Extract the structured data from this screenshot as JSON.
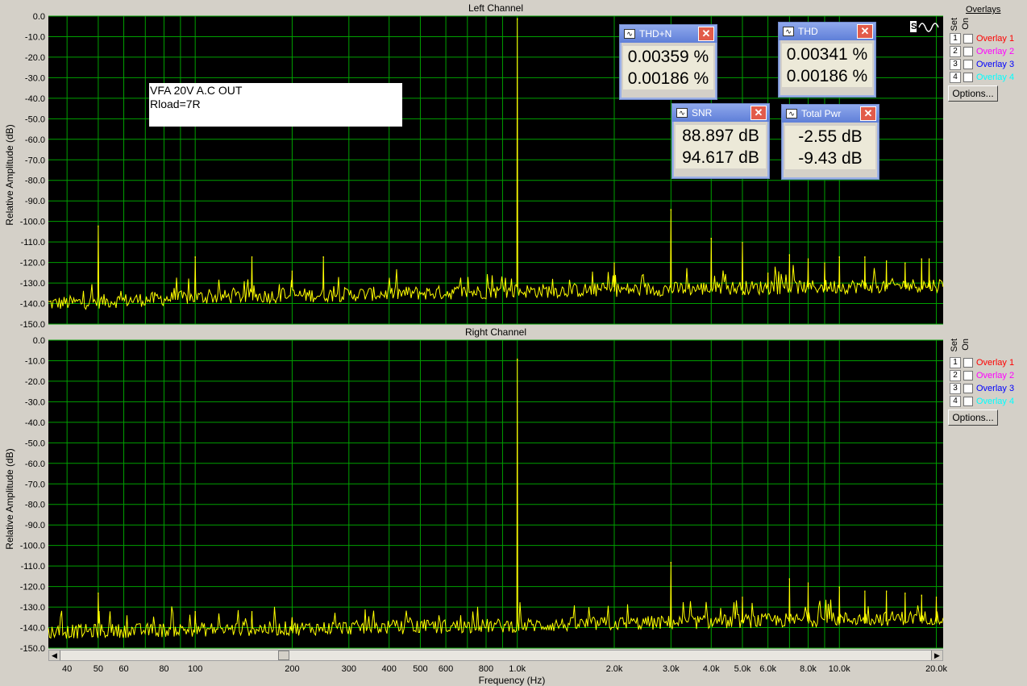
{
  "charts": {
    "left": {
      "title": "Left Channel",
      "annotation": [
        "VFA 20V A.C OUT",
        "Rload=7R"
      ]
    },
    "right": {
      "title": "Right Channel"
    }
  },
  "chart_data": [
    {
      "type": "line",
      "title": "Left Channel",
      "xlabel": "Frequency (Hz)",
      "ylabel": "Relative Amplitude (dB)",
      "xscale": "log",
      "xlim": [
        35,
        21000
      ],
      "ylim": [
        -150,
        0
      ],
      "grid": true,
      "series_color": "#ffff00",
      "noise_floor_db": [
        [
          36,
          -140
        ],
        [
          100,
          -137
        ],
        [
          1000,
          -134
        ],
        [
          20000,
          -131
        ]
      ],
      "peaks": {
        "x": [
          50,
          100,
          150,
          200,
          250,
          1000,
          2000,
          3000,
          4000,
          5000,
          6000,
          7000,
          8000,
          9000,
          10000,
          12000,
          14000,
          16000,
          18000,
          19000
        ],
        "y": [
          -102,
          -117,
          -117,
          -124,
          -117,
          -1,
          -120,
          -94,
          -108,
          -110,
          -125,
          -116,
          -118,
          -120,
          -117,
          -117,
          -119,
          -120,
          -118,
          -118
        ]
      }
    },
    {
      "type": "line",
      "title": "Right Channel",
      "xlabel": "Frequency (Hz)",
      "ylabel": "Relative Amplitude (dB)",
      "xscale": "log",
      "xlim": [
        35,
        21000
      ],
      "ylim": [
        -150,
        0
      ],
      "grid": true,
      "series_color": "#ffff00",
      "noise_floor_db": [
        [
          36,
          -142
        ],
        [
          100,
          -141
        ],
        [
          1000,
          -139
        ],
        [
          20000,
          -135
        ]
      ],
      "peaks": {
        "x": [
          50,
          100,
          150,
          200,
          1000,
          3000,
          5000,
          7000,
          8000,
          10000,
          12000,
          14000,
          16000,
          18000,
          20000
        ],
        "y": [
          -123,
          -132,
          -132,
          -135,
          -9,
          -108,
          -125,
          -116,
          -118,
          -120,
          -122,
          -122,
          -123,
          -124,
          -125
        ]
      }
    }
  ],
  "y_ticks": [
    "0.0",
    "-10.0",
    "-20.0",
    "-30.0",
    "-40.0",
    "-50.0",
    "-60.0",
    "-70.0",
    "-80.0",
    "-90.0",
    "-100.0",
    "-110.0",
    "-120.0",
    "-130.0",
    "-140.0",
    "-150.0"
  ],
  "x_ticks": [
    {
      "v": 40,
      "l": "40"
    },
    {
      "v": 50,
      "l": "50"
    },
    {
      "v": 60,
      "l": "60"
    },
    {
      "v": 80,
      "l": "80"
    },
    {
      "v": 100,
      "l": "100"
    },
    {
      "v": 200,
      "l": "200"
    },
    {
      "v": 300,
      "l": "300"
    },
    {
      "v": 400,
      "l": "400"
    },
    {
      "v": 500,
      "l": "500"
    },
    {
      "v": 600,
      "l": "600"
    },
    {
      "v": 800,
      "l": "800"
    },
    {
      "v": 1000,
      "l": "1.0k"
    },
    {
      "v": 2000,
      "l": "2.0k"
    },
    {
      "v": 3000,
      "l": "3.0k"
    },
    {
      "v": 4000,
      "l": "4.0k"
    },
    {
      "v": 5000,
      "l": "5.0k"
    },
    {
      "v": 6000,
      "l": "6.0k"
    },
    {
      "v": 8000,
      "l": "8.0k"
    },
    {
      "v": 10000,
      "l": "10.0k"
    },
    {
      "v": 20000,
      "l": "20.0k"
    }
  ],
  "meters": {
    "thdn": {
      "label": "THD+N",
      "v1": "0.00359 %",
      "v2": "0.00186 %"
    },
    "thd": {
      "label": "THD",
      "v1": "0.00341 %",
      "v2": "0.00186 %"
    },
    "snr": {
      "label": "SNR",
      "v1": "88.897 dB",
      "v2": "94.617 dB"
    },
    "pwr": {
      "label": "Total Pwr",
      "v1": "-2.55 dB",
      "v2": "-9.43 dB"
    }
  },
  "overlays": {
    "header": "Overlays",
    "set_label": "Set",
    "on_label": "On",
    "options_label": "Options...",
    "items": [
      {
        "num": "1",
        "label": "Overlay 1",
        "color": "#ff0000"
      },
      {
        "num": "2",
        "label": "Overlay 2",
        "color": "#ff00ff"
      },
      {
        "num": "3",
        "label": "Overlay 3",
        "color": "#0000ff"
      },
      {
        "num": "4",
        "label": "Overlay 4",
        "color": "#00ffff"
      }
    ]
  },
  "xaxis_label": "Frequency (Hz)"
}
